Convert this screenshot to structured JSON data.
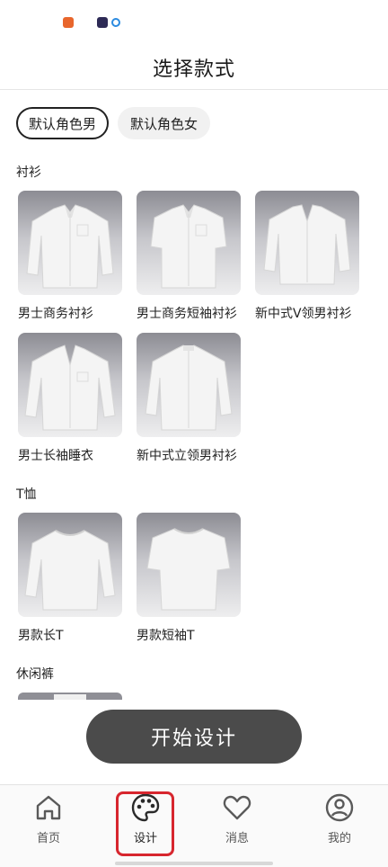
{
  "header": {
    "title": "选择款式"
  },
  "role_tabs": [
    {
      "label": "默认角色男",
      "active": true
    },
    {
      "label": "默认角色女",
      "active": false
    }
  ],
  "sections": [
    {
      "title": "衬衫",
      "items": [
        {
          "label": "男士商务衬衫"
        },
        {
          "label": "男士商务短袖衬衫"
        },
        {
          "label": "新中式V领男衬衫"
        },
        {
          "label": "男士长袖睡衣"
        },
        {
          "label": "新中式立领男衬衫"
        }
      ]
    },
    {
      "title": "T恤",
      "items": [
        {
          "label": "男款长T"
        },
        {
          "label": "男款短袖T"
        }
      ]
    },
    {
      "title": "休闲裤",
      "items": []
    }
  ],
  "action": {
    "start_label": "开始设计"
  },
  "tabbar": [
    {
      "label": "首页",
      "icon": "home-icon"
    },
    {
      "label": "设计",
      "icon": "palette-icon",
      "active": true
    },
    {
      "label": "消息",
      "icon": "heart-icon"
    },
    {
      "label": "我的",
      "icon": "user-icon"
    }
  ],
  "colors": {
    "button": "#4b4b4b",
    "highlight": "#d7262e",
    "active_border": "#222222"
  }
}
